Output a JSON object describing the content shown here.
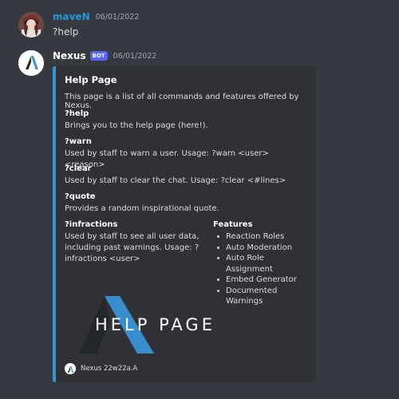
{
  "messages": {
    "user": {
      "username": "maveN",
      "timestamp": "06/01/2022",
      "content": "?help",
      "name_color": "#1f9bde"
    },
    "bot": {
      "username": "Nexus",
      "badge": "BOT",
      "timestamp": "06/01/2022",
      "name_color": "#ffffff"
    }
  },
  "embed": {
    "accent_color": "#3994d6",
    "title": "Help Page",
    "description": "This page is a list of all commands and features offered by Nexus.",
    "commands": [
      {
        "name": "?help",
        "value": "Brings you to the help page (here!)."
      },
      {
        "name": "?warn",
        "value": "Used by staff to warn a user. Usage: ?warn <user> <reason>"
      },
      {
        "name": "?clear",
        "value": "Used by staff to clear the chat. Usage: ?clear <#lines>"
      },
      {
        "name": "?quote",
        "value": "Provides a random inspirational quote."
      },
      {
        "name": "?infractions",
        "value": "Used by staff to see all user data, including past warnings. Usage: ?infractions <user>"
      }
    ],
    "features": {
      "name": "Features",
      "items": [
        "Reaction Roles",
        "Auto Moderation",
        "Auto Role Assignment",
        "Embed Generator",
        "Documented Warnings"
      ]
    },
    "image_text": "HELP PAGE",
    "footer": "Nexus 22w22a.A"
  }
}
